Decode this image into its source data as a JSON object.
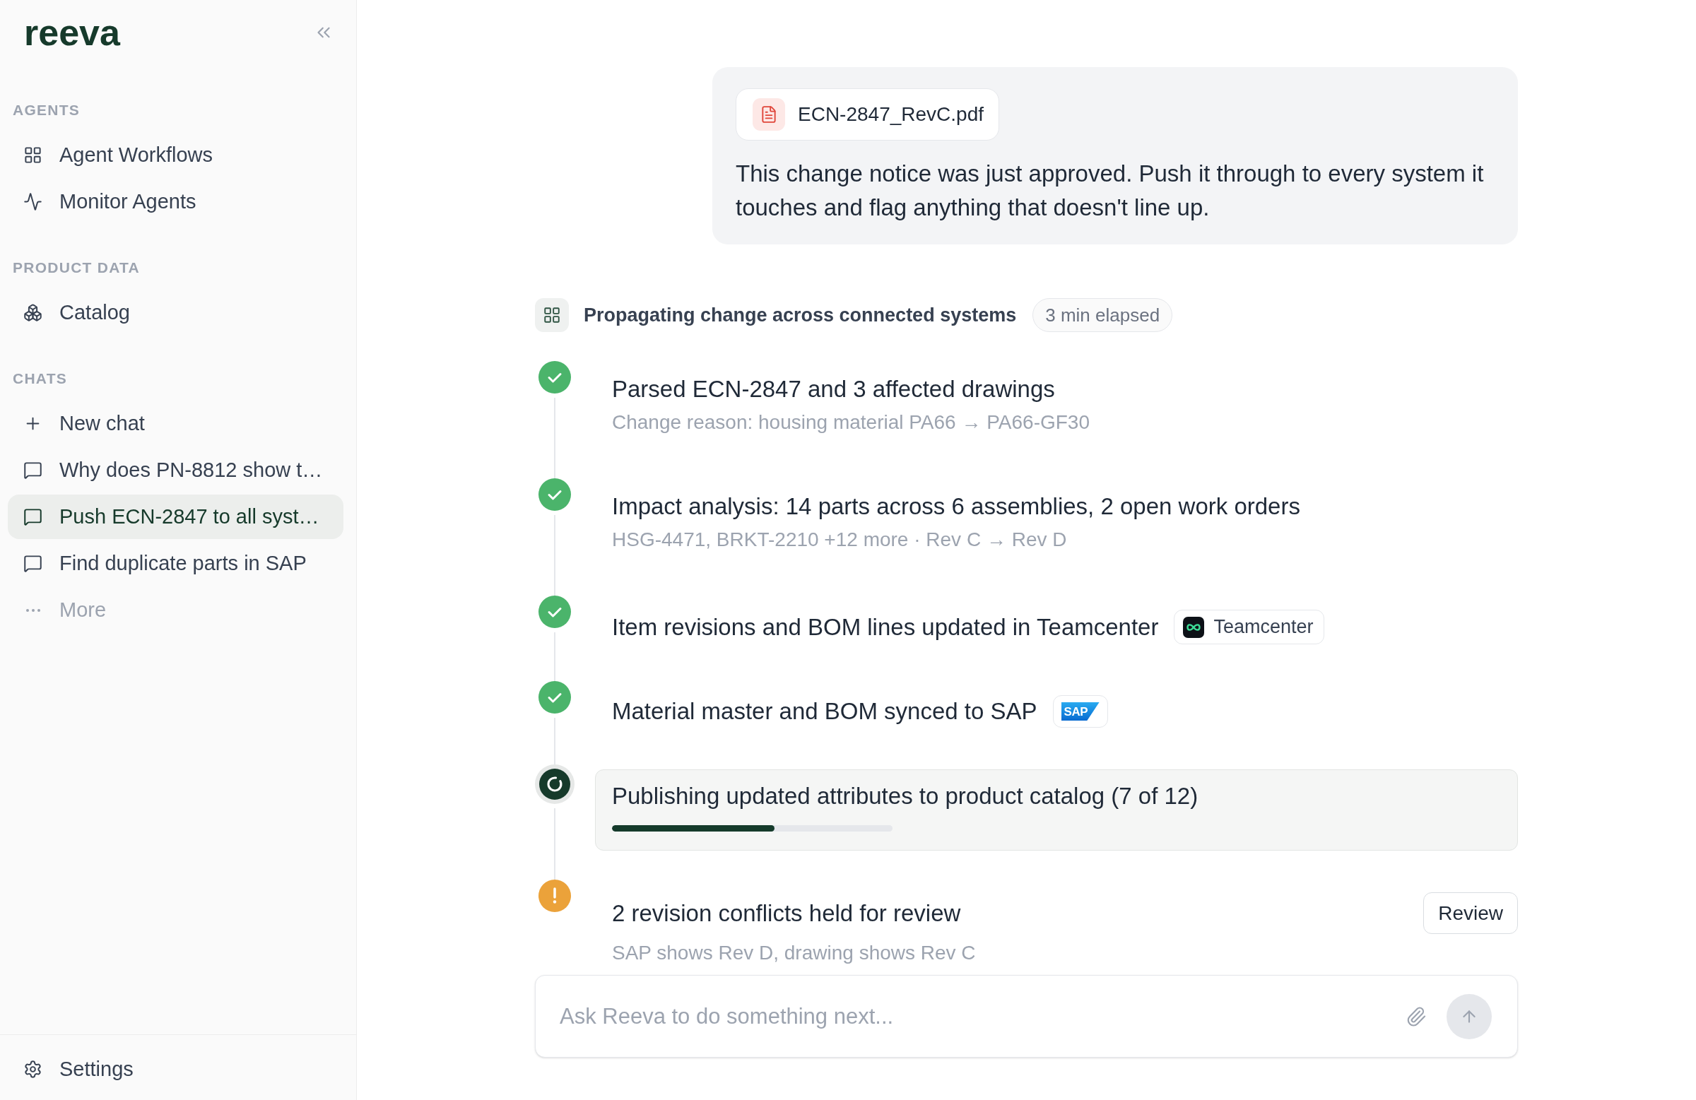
{
  "sidebar": {
    "logo": "reeva",
    "sections": [
      {
        "heading": "AGENTS",
        "items": [
          {
            "kind": "workflows",
            "label": "Agent Workflows",
            "selected": false
          },
          {
            "kind": "monitor",
            "label": "Monitor Agents",
            "selected": false
          }
        ]
      },
      {
        "heading": "PRODUCT DATA",
        "items": [
          {
            "kind": "catalog",
            "label": "Catalog",
            "selected": false
          }
        ]
      },
      {
        "heading": "CHATS",
        "items": [
          {
            "kind": "new",
            "label": "New chat",
            "selected": false
          },
          {
            "kind": "chat",
            "label": "Why does PN-8812 show t…",
            "selected": false
          },
          {
            "kind": "chat",
            "label": "Push ECN-2847 to all syst…",
            "selected": true
          },
          {
            "kind": "chat",
            "label": "Find duplicate parts in SAP",
            "selected": false
          },
          {
            "kind": "more",
            "label": "More",
            "selected": false
          }
        ]
      }
    ],
    "footer": {
      "label": "Settings"
    }
  },
  "message": {
    "attachment": {
      "name": "ECN-2847_RevC.pdf"
    },
    "text": "This change notice was just approved. Push it through to every system it touches and flag anything that doesn't line up."
  },
  "task": {
    "title": "Propagating change across connected systems",
    "elapsed": "3 min elapsed",
    "steps": [
      {
        "kind": "done",
        "title": "Parsed ECN-2847 and 3 affected drawings",
        "detail": "Change reason: housing material PA66 → PA66-GF30"
      },
      {
        "kind": "done",
        "title": "Impact analysis: 14 parts across 6 assemblies, 2 open work orders",
        "detail": "HSG-4471, BRKT-2210 +12 more · Rev C → Rev D"
      },
      {
        "kind": "done",
        "title": "Item revisions and BOM lines updated in Teamcenter",
        "badge": {
          "kind": "icon_label",
          "label": "Teamcenter"
        }
      },
      {
        "kind": "done",
        "title": "Material master and BOM synced to SAP",
        "badge": {
          "kind": "logo",
          "label": "SAP"
        }
      },
      {
        "kind": "running",
        "title": "Publishing updated attributes to product catalog (7 of 12)",
        "level": 0.58
      },
      {
        "kind": "warning",
        "title": "2 revision conflicts held for review",
        "detail": "SAP shows Rev D, drawing shows Rev C",
        "action": "Review"
      }
    ]
  },
  "composer": {
    "placeholder": "Ask Reeva to do something next..."
  }
}
